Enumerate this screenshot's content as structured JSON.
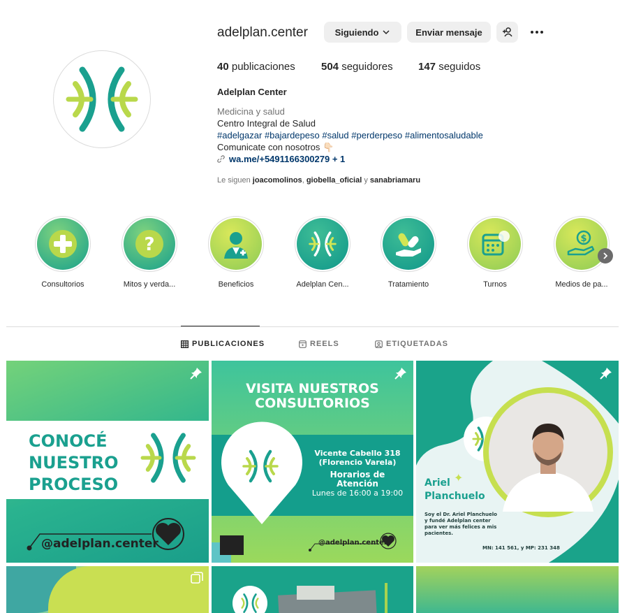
{
  "profile": {
    "username": "adelplan.center",
    "follow_button": "Siguiendo",
    "message_button": "Enviar mensaje",
    "stats": {
      "posts_count": "40",
      "posts_label": "publicaciones",
      "followers_count": "504",
      "followers_label": "seguidores",
      "following_count": "147",
      "following_label": "seguidos"
    },
    "full_name": "Adelplan Center",
    "category": "Medicina y salud",
    "bio_line1": "Centro Integral de Salud",
    "bio_tags": "#adelgazar #bajardepeso #salud #perderpeso #alimentosaludable",
    "bio_line3": "Comunicate con nosotros 👇🏻",
    "link": "wa.me/+5491166300279 + 1",
    "followed_by_prefix": "Le siguen",
    "followed_by_1": "joacomolinos",
    "followed_by_sep": ",",
    "followed_by_2": "giobella_oficial",
    "followed_by_and": "y",
    "followed_by_3": "sanabriamaru"
  },
  "highlights": [
    {
      "label": "Consultorios",
      "icon": "plus-icon"
    },
    {
      "label": "Mitos y verda...",
      "icon": "question-icon"
    },
    {
      "label": "Beneficios",
      "icon": "doctor-icon"
    },
    {
      "label": "Adelplan Cen...",
      "icon": "logo-icon"
    },
    {
      "label": "Tratamiento",
      "icon": "pills-hand-icon"
    },
    {
      "label": "Turnos",
      "icon": "calendar-chat-icon"
    },
    {
      "label": "Medios de pa...",
      "icon": "money-hand-icon"
    }
  ],
  "tabs": [
    {
      "label": "PUBLICACIONES",
      "active": true
    },
    {
      "label": "REELS",
      "active": false
    },
    {
      "label": "ETIQUETADAS",
      "active": false
    }
  ],
  "posts": {
    "p1": {
      "line1": "CONOCÉ",
      "line2": "NUESTRO",
      "line3": "PROCESO",
      "handle": "@adelplan.center"
    },
    "p2": {
      "title1": "VISITA NUESTROS",
      "title2": "CONSULTORIOS",
      "address1": "Vicente Cabello 318",
      "address2": "(Florencio Varela)",
      "hours_title": "Horarios de Atención",
      "hours": "Lunes de 16:00 a 19:00",
      "handle": "@adelplan.center"
    },
    "p3": {
      "name1": "Ariel",
      "name2": "Planchuelo",
      "text1": "Soy el Dr. Ariel Planchuelo",
      "text2": "y fundé Adelplan center",
      "text3": "para ver más felices a mis",
      "text4": "pacientes.",
      "license": "MN: 141 561, y MP: 231 348"
    }
  },
  "colors": {
    "brand_teal": "#13a08f",
    "brand_lime": "#b9d84b",
    "link_blue": "#00376b"
  }
}
